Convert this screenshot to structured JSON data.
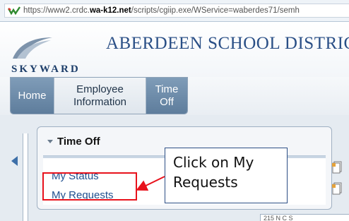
{
  "browser": {
    "url_prefix": "https://www2.crdc.",
    "url_host": "wa-k12.net",
    "url_path": "/scripts/cgiip.exe/WService=waberdes71/semh"
  },
  "header": {
    "brand": "SKYWARD",
    "district_title": "ABERDEEN SCHOOL DISTRIC"
  },
  "tabs": [
    {
      "label_line1": "Home",
      "label_line2": ""
    },
    {
      "label_line1": "Employee",
      "label_line2": "Information"
    },
    {
      "label_line1": "Time",
      "label_line2": "Off"
    }
  ],
  "panel": {
    "title": "Time Off",
    "links": [
      "My Status",
      "My Requests"
    ]
  },
  "callout": {
    "line1": "Click on My",
    "line2": "Requests"
  },
  "footer_fragment": "215 N C S",
  "colors": {
    "highlight": "#e8121c",
    "callout_border": "#2c4e85",
    "link": "#1f4f8f",
    "tab_active": "#6f8dac"
  }
}
